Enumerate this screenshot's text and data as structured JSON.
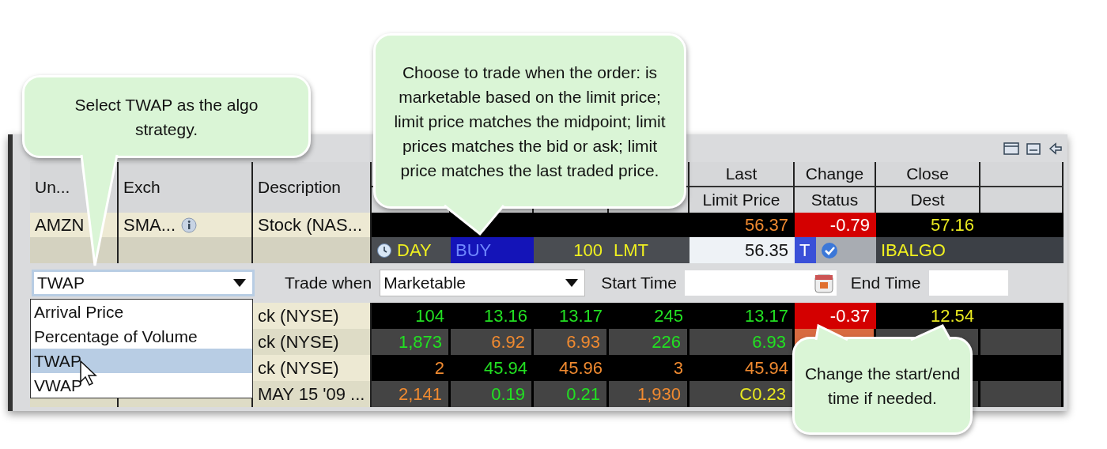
{
  "callouts": [
    {
      "kind": "tail_down",
      "text": "Select TWAP as the algo strategy."
    },
    {
      "kind": "tail_down",
      "text": "Choose to trade when the order: is marketable based on the limit price; limit price matches the midpoint; limit prices matches the bid or ask; limit price matches the last traded price."
    },
    {
      "kind": "tail_up",
      "text": "Change the start/end time if needed."
    }
  ],
  "table": {
    "tall_columns": [
      "Un...",
      "Exch",
      "Description"
    ],
    "stacked_columns": [
      {
        "top": "Last",
        "bottom": "Limit Price"
      },
      {
        "top": "Change",
        "bottom": "Status"
      },
      {
        "top": "Close",
        "bottom": "Dest"
      }
    ],
    "quote_row": {
      "symbol": {
        "text": "AMZN"
      },
      "exchange": {
        "text": "SMA...",
        "info": true
      },
      "description": {
        "text": "Stock (NAS..."
      },
      "last": {
        "text": "56.37",
        "color": "#f08a30"
      },
      "change": {
        "text": "-0.79",
        "color": "#d40000"
      },
      "close": {
        "text": "57.16",
        "color": "#e8e820"
      }
    },
    "order_row": {
      "tif": "DAY",
      "action": "BUY",
      "qty": "100",
      "type": "LMT",
      "limit_price": "56.35",
      "status": "T",
      "transmitted": true,
      "dest": "IBALGO"
    },
    "algo": {
      "strategy": {
        "value": "TWAP",
        "expanded": true,
        "options": [
          {
            "label": "Arrival Price",
            "selected": false
          },
          {
            "label": "Percentage of Volume",
            "selected": false
          },
          {
            "label": "TWAP",
            "selected": true
          },
          {
            "label": "VWAP",
            "selected": false
          }
        ]
      },
      "trade_when": {
        "label": "Trade when",
        "value": "Marketable"
      },
      "start_time": {
        "label": "Start Time"
      },
      "end_time": {
        "label": "End Time"
      }
    },
    "rows": [
      {
        "description": {
          "text": "ck (NYSE)"
        },
        "bid_size": {
          "text": "104",
          "color": "#22e022"
        },
        "bid": {
          "text": "13.16",
          "color": "#22e022"
        },
        "ask": {
          "text": "13.17",
          "color": "#22e022"
        },
        "ask_size": {
          "text": "245",
          "color": "#22e022"
        },
        "last": {
          "text": "13.17",
          "color": "#22e022"
        },
        "change": {
          "text": "-0.37",
          "color": "#d40000"
        },
        "close": {
          "text": "12.54",
          "color": "#e8e820"
        }
      },
      {
        "description": {
          "text": "ck (NYSE)"
        },
        "bid_size": {
          "text": "1,873",
          "color": "#22e022"
        },
        "bid": {
          "text": "6.92",
          "color": "#f08a30"
        },
        "ask": {
          "text": "6.93",
          "color": "#f08a30"
        },
        "ask_size": {
          "text": "226",
          "color": "#22e022"
        },
        "last": {
          "text": "6.93",
          "color": "#22e022"
        },
        "change": {
          "color": "#d86a40"
        }
      },
      {
        "description": {
          "text": "ck (NYSE)"
        },
        "bid_size": {
          "text": "2",
          "color": "#f08a30"
        },
        "bid": {
          "text": "45.94",
          "color": "#22e022"
        },
        "ask": {
          "text": "45.96",
          "color": "#f08a30"
        },
        "ask_size": {
          "text": "3",
          "color": "#f08a30"
        },
        "last": {
          "text": "45.94",
          "color": "#f08a30"
        }
      },
      {
        "description": {
          "text": "MAY 15 '09 ..."
        },
        "bid_size": {
          "text": "2,141",
          "color": "#f08a30"
        },
        "bid": {
          "text": "0.19",
          "color": "#22e022"
        },
        "ask": {
          "text": "0.21",
          "color": "#22e022"
        },
        "ask_size": {
          "text": "1,930",
          "color": "#f08a30"
        },
        "last": {
          "text": "C0.23",
          "color": "#e8e820"
        }
      }
    ]
  }
}
